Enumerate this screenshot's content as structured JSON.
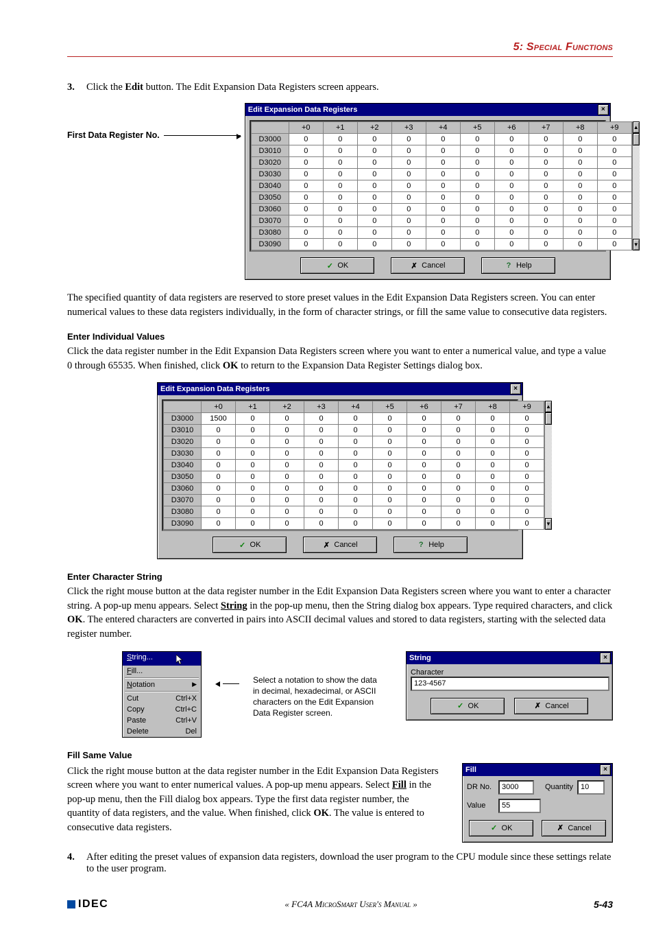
{
  "chapter_header": "5: Special Functions",
  "step3": {
    "num": "3.",
    "text_pre": "Click the ",
    "bold": "Edit",
    "text_post": " button. The Edit Expansion Data Registers screen appears."
  },
  "first_dr_label": "First Data Register No.",
  "edit_dlg": {
    "title": "Edit Expansion Data Registers",
    "col_headers": [
      "",
      "+0",
      "+1",
      "+2",
      "+3",
      "+4",
      "+5",
      "+6",
      "+7",
      "+8",
      "+9"
    ],
    "rows1": [
      "D3000",
      "D3010",
      "D3020",
      "D3030",
      "D3040",
      "D3050",
      "D3060",
      "D3070",
      "D3080",
      "D3090"
    ],
    "zeros": [
      "0",
      "0",
      "0",
      "0",
      "0",
      "0",
      "0",
      "0",
      "0",
      "0"
    ],
    "ok": "OK",
    "cancel": "Cancel",
    "help": "Help"
  },
  "para1": "The specified quantity of data registers are reserved to store preset values in the Edit Expansion Data Registers screen. You can enter numerical values to these data registers individually, in the form of character strings, or fill the same value to consecutive data registers.",
  "sec_indiv": "Enter Individual Values",
  "para2_a": "Click the data register number in the Edit Expansion Data Registers screen where you want to enter a numerical value, and type a value 0 through 65535. When finished, click ",
  "para2_b": " to return to the Expansion Data Register Settings dialog box.",
  "ok_bold": "OK",
  "edit_dlg2_firstcell": "1500",
  "sec_str": "Enter Character String",
  "para3_a": "Click the right mouse button at the data register number in the Edit Expansion Data Registers screen where you want to enter a character string. A pop-up menu appears. Select ",
  "para3_b": " in the pop-up menu, then the String dialog box appears. Type required characters, and click ",
  "para3_c": ". The entered characters are converted in pairs into ASCII decimal values and stored to data registers, starting with the selected data register number.",
  "string_u": "String",
  "ctx": {
    "string": "String...",
    "fill": "Fill...",
    "notation": "Notation",
    "cut": "Cut",
    "cut_k": "Ctrl+X",
    "copy": "Copy",
    "copy_k": "Ctrl+C",
    "paste": "Paste",
    "paste_k": "Ctrl+V",
    "delete": "Delete",
    "delete_k": "Del"
  },
  "notation_note": "Select a notation to show the data in decimal, hexadecimal, or ASCII characters on the Edit Expansion Data Register screen.",
  "string_dlg": {
    "title": "String",
    "character_label": "Character",
    "value": "123-4567",
    "ok": "OK",
    "cancel": "Cancel"
  },
  "sec_fill": "Fill Same Value",
  "para4_a": "Click the right mouse button at the data register number in the Edit Expansion Data Registers screen where you want to enter numerical values. A pop-up menu appears. Select ",
  "para4_b": " in the pop-up menu, then the Fill dialog box appears. Type the first data register number, the quantity of data registers, and the value. When finished, click ",
  "para4_c": ". The value is entered to consecutive data registers.",
  "fill_u": "Fill",
  "fill_dlg": {
    "title": "Fill",
    "dr_label": "DR No.",
    "dr_value": "3000",
    "qty_label": "Quantity",
    "qty_value": "10",
    "val_label": "Value",
    "val_value": "55",
    "ok": "OK",
    "cancel": "Cancel"
  },
  "step4": {
    "num": "4.",
    "text": "After editing the preset values of expansion data registers, download the user program to the CPU module since these settings relate to the user program."
  },
  "footer": {
    "logo": "IDEC",
    "mid": "« FC4A MicroSmart User's Manual »",
    "pg": "5-43"
  }
}
